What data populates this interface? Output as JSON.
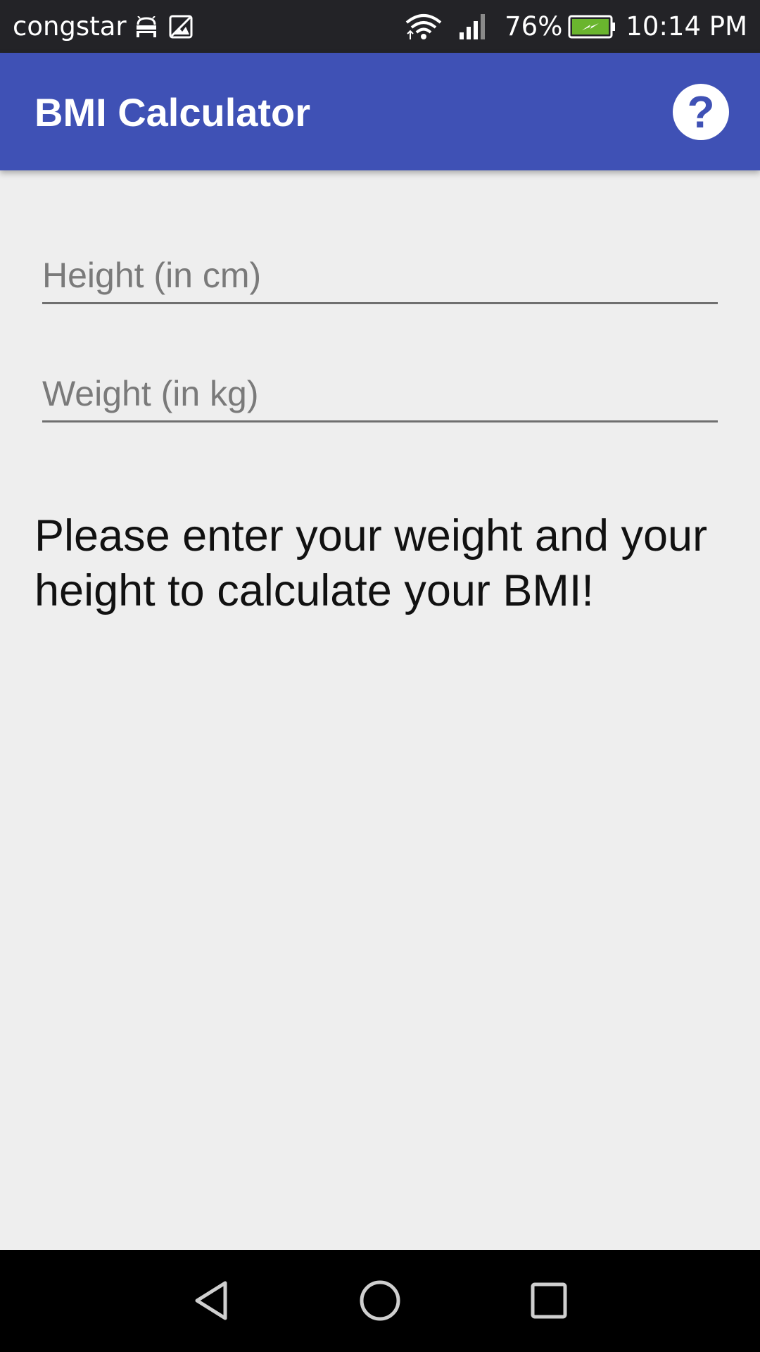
{
  "status_bar": {
    "carrier": "congstar",
    "icons": [
      "android-debug-icon",
      "image-icon",
      "wifi-icon",
      "signal-icon",
      "battery-charging-icon"
    ],
    "battery_percent": "76%",
    "time": "10:14 PM"
  },
  "app_bar": {
    "title": "BMI Calculator",
    "help_label": "?",
    "color": "#3f51b5"
  },
  "form": {
    "height_placeholder": "Height (in cm)",
    "height_value": "",
    "weight_placeholder": "Weight (in kg)",
    "weight_value": ""
  },
  "message": "Please enter your weight and your height to calculate your BMI!",
  "nav_bar": {
    "icons": [
      "back-icon",
      "home-icon",
      "recents-icon"
    ]
  }
}
